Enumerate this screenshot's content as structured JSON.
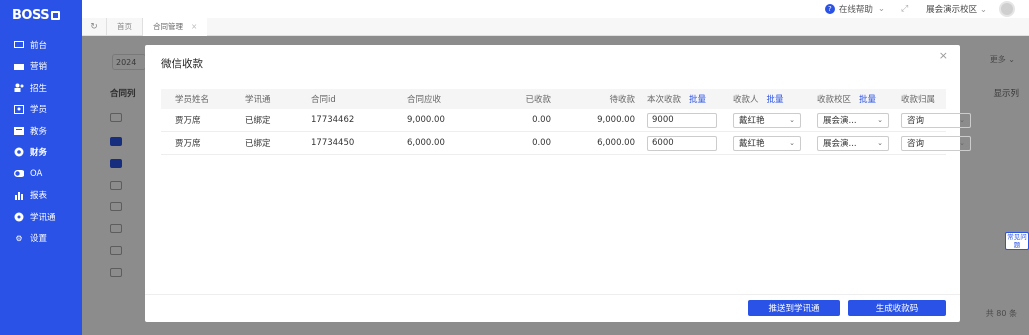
{
  "logo": {
    "text": "BOSS"
  },
  "sidebar": {
    "items": [
      {
        "label": "前台",
        "icon": "monitor-icon"
      },
      {
        "label": "营销",
        "icon": "store-icon"
      },
      {
        "label": "招生",
        "icon": "users-icon"
      },
      {
        "label": "学员",
        "icon": "id-card-icon"
      },
      {
        "label": "教务",
        "icon": "book-icon"
      },
      {
        "label": "财务",
        "icon": "money-icon"
      },
      {
        "label": "OA",
        "icon": "toggle-icon"
      },
      {
        "label": "报表",
        "icon": "bar-chart-icon"
      },
      {
        "label": "学讯通",
        "icon": "message-icon"
      },
      {
        "label": "设置",
        "icon": "gear-icon"
      }
    ]
  },
  "topbar": {
    "help": "在线帮助",
    "school": "展会演示校区"
  },
  "tabs": {
    "home": "首页",
    "contract": "合同管理",
    "close": "×"
  },
  "background": {
    "filter": "2024",
    "more": "更多",
    "list_title": "合同列",
    "column_setting": "显示列",
    "total": "共 80 条",
    "faq": "常见问题"
  },
  "modal": {
    "title": "微信收款",
    "close": "×",
    "columns": {
      "name": "学员姓名",
      "xxt": "学讯通",
      "contract_id": "合同id",
      "due": "合同应收",
      "received": "已收款",
      "pending": "待收款",
      "this_time": "本次收款",
      "payee": "收款人",
      "campus": "收款校区",
      "belong": "收款归属",
      "batch": "批量"
    },
    "rows": [
      {
        "name": "贾万席",
        "xxt": "已绑定",
        "contract_id": "17734462",
        "due": "9,000.00",
        "received": "0.00",
        "pending": "9,000.00",
        "this_time": "9000",
        "payee": "戴红艳",
        "campus": "展会演...",
        "belong": "咨询"
      },
      {
        "name": "贾万席",
        "xxt": "已绑定",
        "contract_id": "17734450",
        "due": "6,000.00",
        "received": "0.00",
        "pending": "6,000.00",
        "this_time": "6000",
        "payee": "戴红艳",
        "campus": "展会演...",
        "belong": "咨询"
      }
    ],
    "push_button": "推送到学讯通",
    "qr_button": "生成收款码"
  }
}
